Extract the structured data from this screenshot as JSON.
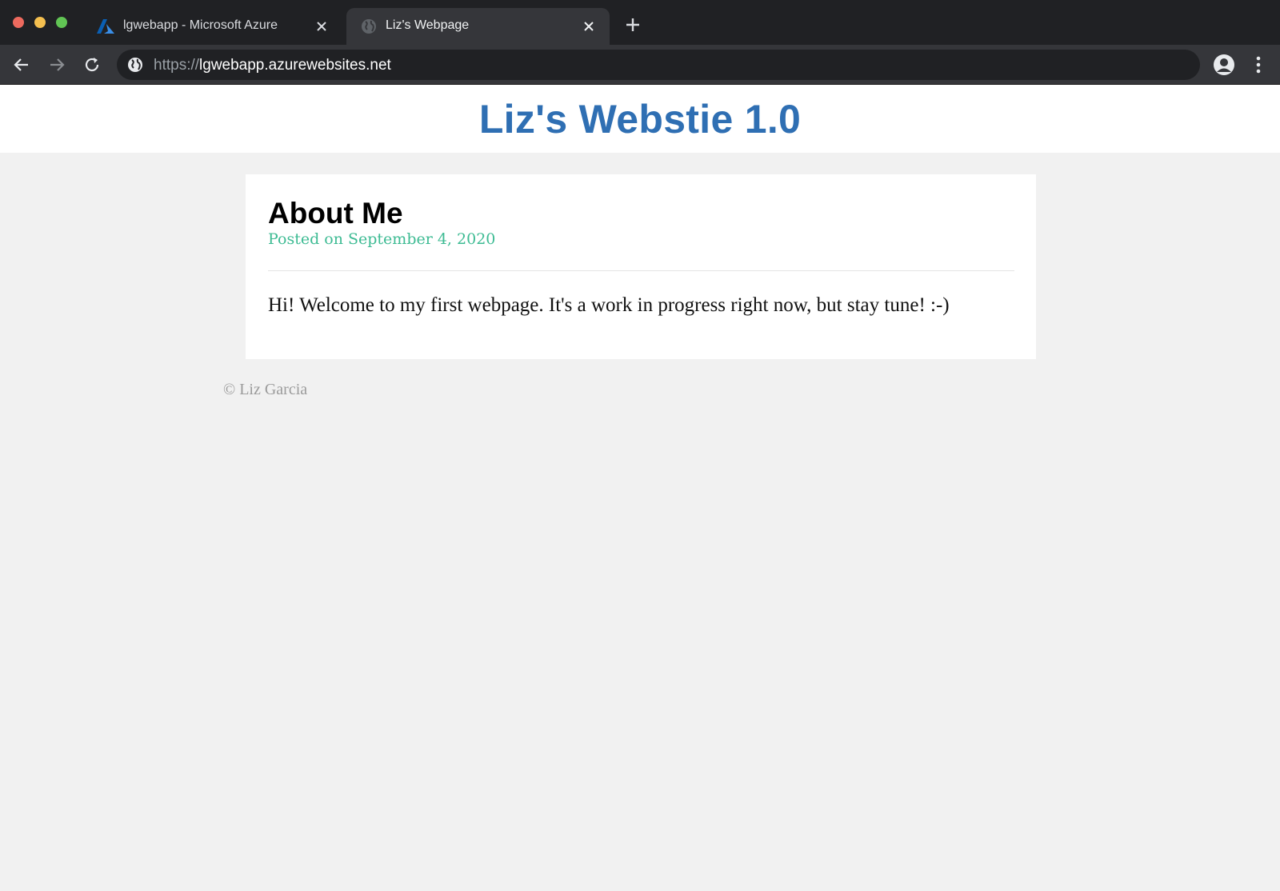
{
  "browser": {
    "tabs": [
      {
        "title": "lgwebapp - Microsoft Azure",
        "icon": "azure-logo-icon",
        "active": false
      },
      {
        "title": "Liz's Webpage",
        "icon": "globe-icon",
        "active": true
      }
    ],
    "address_bar": {
      "scheme": "https://",
      "host": "lgwebapp.azurewebsites.net"
    },
    "colors": {
      "frame": "#202124",
      "toolbar": "#35363a",
      "accent_azure": "#0078d4"
    }
  },
  "site": {
    "title": "Liz's Webstie 1.0",
    "title_color": "#2f6fb3"
  },
  "post": {
    "title": "About Me",
    "date": "Posted on September 4, 2020",
    "date_color": "#3dbb93",
    "body": "Hi! Welcome to my first webpage. It's a work in progress right now, but stay tune! :-)"
  },
  "footer": {
    "copyright": "© Liz Garcia"
  }
}
